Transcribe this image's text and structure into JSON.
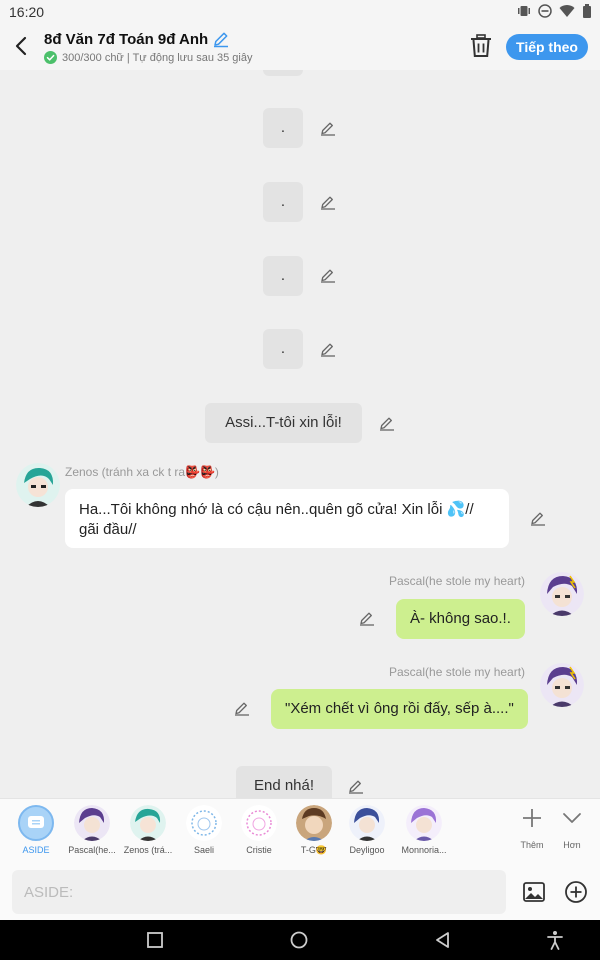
{
  "status_bar": {
    "time": "16:20"
  },
  "header": {
    "title": "8đ Văn 7đ Toán 9đ Anh",
    "subtitle": "300/300 chữ | Tự động lưu sau 35 giây",
    "follow_label": "Tiếp theo"
  },
  "messages": {
    "aside_dot_1": ".",
    "aside_dot_2": ".",
    "aside_dot_3": ".",
    "aside_dot_4": ".",
    "aside_apology": "Assi...T-tôi xin lỗi!",
    "zenos_name": "Zenos (tránh xa ck t ra👺👺)",
    "zenos_text": "Ha...Tôi không nhớ là có cậu nên..quên gõ cửa! Xin lỗi 💦// gãi đầu//",
    "pascal_name_1": "Pascal(he stole my heart)",
    "pascal_text_1": "À- không sao.!.",
    "pascal_name_2": "Pascal(he stole my heart)",
    "pascal_text_2": "\"Xém chết vì ông rồi đấy, sếp à....\"",
    "aside_end": "End nhá!"
  },
  "characters": [
    {
      "label": "ASIDE",
      "color": "#a9d3f7"
    },
    {
      "label": "Pascal(he...",
      "color": "#6a4d9a"
    },
    {
      "label": "Zenos (trá...",
      "color": "#2fa89a"
    },
    {
      "label": "Saeli",
      "color": "#7fb7e8"
    },
    {
      "label": "Cristie",
      "color": "#e98ad6"
    },
    {
      "label": "T-G🤓",
      "color": "#5a7ab0"
    },
    {
      "label": "Deyligoo",
      "color": "#3b4f9a"
    },
    {
      "label": "Monnoria...",
      "color": "#9b73d6"
    }
  ],
  "tools": {
    "more_label": "Thêm",
    "hide_label": "Hơn"
  },
  "input": {
    "placeholder": "ASIDE:"
  },
  "colors": {
    "accent": "#3d97ee",
    "bubble_green": "#cdef8f",
    "aside_bubble": "#e3e3e3"
  }
}
